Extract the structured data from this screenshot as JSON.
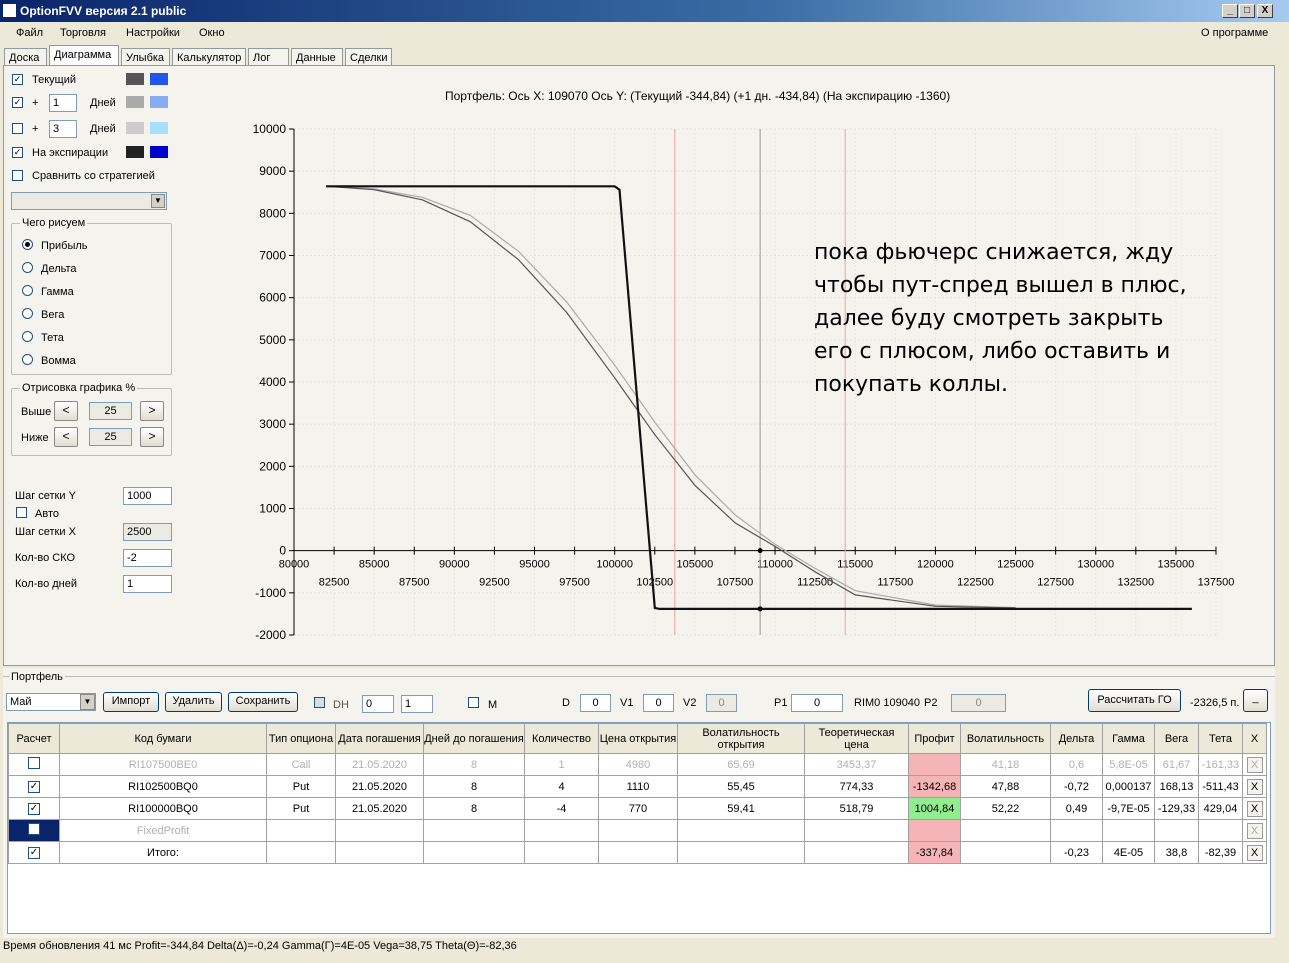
{
  "window": {
    "title": "OptionFVV версия 2.1 public",
    "min": "_",
    "max": "□",
    "close": "X"
  },
  "menu": {
    "file": "Файл",
    "trade": "Торговля",
    "settings": "Настройки",
    "window": "Окно",
    "about": "О программе"
  },
  "tabs": [
    "Доска",
    "Диаграмма",
    "Улыбка",
    "Калькулятор",
    "Лог",
    "Данные",
    "Сделки"
  ],
  "left": {
    "current": "Текущий",
    "plus": "+",
    "days": "Дней",
    "plus1_value": "1",
    "plus3_value": "3",
    "expiry": "На экспирации",
    "compare": "Сравнить со стратегией",
    "draw_group": "Чего рисуем",
    "draw_opts": [
      "Прибыль",
      "Дельта",
      "Гамма",
      "Вега",
      "Тета",
      "Вомма"
    ],
    "render_group": "Отрисовка графика %",
    "above": "Выше",
    "below": "Ниже",
    "above_val": "25",
    "below_val": "25",
    "prev": "<",
    "next": ">",
    "stepy_label": "Шаг сетки Y",
    "stepy": "1000",
    "auto": "Авто",
    "stepx_label": "Шаг сетки X",
    "stepx": "2500",
    "sko_label": "Кол-во СКО",
    "sko": "-2",
    "days_label": "Кол-во дней",
    "days_val": "1",
    "colors": {
      "current_dark": "#555555",
      "current_light": "#2255ee",
      "p1_dark": "#aaaaaa",
      "p1_light": "#88aaee",
      "p3_dark": "#cccccc",
      "p3_light": "#aaddff",
      "exp_dark": "#222222",
      "exp_light": "#0000cc"
    }
  },
  "chart_header": "Портфель: Ось X:  109070 Ось Y:  (Текущий -344,84)  (+1 дн. -434,84)  (На экспирацию -1360)",
  "annotation": [
    "пока фьючерс снижается, жду",
    "чтобы пут-спред вышел в плюс,",
    "далее буду смотреть закрыть",
    "его с плюсом, либо оставить и",
    "покупать коллы."
  ],
  "chart_data": {
    "type": "line",
    "xlim": [
      80000,
      137500
    ],
    "ylim": [
      -2000,
      10000
    ],
    "y_ticks": [
      "10000",
      "9000",
      "8000",
      "7000",
      "6000",
      "5000",
      "4000",
      "3000",
      "2000",
      "1000",
      "0",
      "-1000",
      "-2000"
    ],
    "x_ticks_top": [
      "80000",
      "85000",
      "90000",
      "95000",
      "100000",
      "105000",
      "110000",
      "115000",
      "120000",
      "125000",
      "130000",
      "135000"
    ],
    "x_ticks_bottom": [
      "82500",
      "87500",
      "92500",
      "97500",
      "102500",
      "107500",
      "112500",
      "117500",
      "122500",
      "127500",
      "132500",
      "137500"
    ],
    "cursor_x": 109070,
    "red_lines": [
      103750,
      114375
    ],
    "series": [
      {
        "x": [
          82000,
          100000,
          100300,
          102500,
          102800,
          136000
        ],
        "y": [
          8640,
          8640,
          8560,
          -1360,
          -1380,
          -1380
        ]
      },
      {
        "x": [
          82000,
          85000,
          88000,
          91000,
          94000,
          97000,
          100000,
          102500,
          105000,
          107500,
          110000,
          112500,
          115000,
          120000,
          125000
        ],
        "y": [
          8640,
          8560,
          8320,
          7800,
          6900,
          5650,
          4100,
          2750,
          1550,
          660,
          100,
          -500,
          -1050,
          -1320,
          -1360
        ]
      },
      {
        "x": [
          82000,
          85000,
          88000,
          91000,
          94000,
          97000,
          100000,
          102500,
          105000,
          107500,
          110000,
          112500,
          115000,
          120000,
          125000
        ],
        "y": [
          8640,
          8580,
          8380,
          7950,
          7100,
          5900,
          4400,
          3050,
          1800,
          850,
          150,
          -420,
          -950,
          -1290,
          -1350
        ]
      }
    ]
  },
  "portfolio": {
    "group": "Портфель",
    "month": "Май",
    "import": "Импорт",
    "delete": "Удалить",
    "save": "Сохранить",
    "dh": "DH",
    "dh_val1": "0",
    "dh_val2": "1",
    "m": "M",
    "d_label": "D",
    "d": "0",
    "v1_label": "V1",
    "v1": "0",
    "v2_label": "V2",
    "v2": "0",
    "p1_label": "P1",
    "p1": "0",
    "rim": "RIM0 109040",
    "p2_label": "P2",
    "p2": "0",
    "calc_go": "Рассчитать ГО",
    "go_value": "-2326,5 п.",
    "go_btn": "_",
    "headers": [
      "Расчет",
      "Код бумаги",
      "Тип опциона",
      "Дата погашения",
      "Дней до погашения",
      "Количество",
      "Цена открытия",
      "Волатильность открытия",
      "Теоретическая цена",
      "Профит",
      "Волатильность",
      "Дельта",
      "Гамма",
      "Вега",
      "Тета",
      "X"
    ],
    "rows": [
      {
        "check": "",
        "code": "RI107500BE0",
        "type": "Call",
        "date": "21.05.2020",
        "days": "8",
        "qty": "1",
        "price": "4980",
        "vol": "65,69",
        "theo": "3453,37",
        "profit": "",
        "vol2": "41,18",
        "delta": "0,6",
        "gamma": "5,8E-05",
        "vega": "61,67",
        "theta": "-161,33",
        "x": "X"
      },
      {
        "check": "✓",
        "code": "RI102500BQ0",
        "type": "Put",
        "date": "21.05.2020",
        "days": "8",
        "qty": "4",
        "price": "1110",
        "vol": "55,45",
        "theo": "774,33",
        "profit": "-1342,68",
        "vol2": "47,88",
        "delta": "-0,72",
        "gamma": "0,000137",
        "vega": "168,13",
        "theta": "-511,43",
        "x": "X"
      },
      {
        "check": "✓",
        "code": "RI100000BQ0",
        "type": "Put",
        "date": "21.05.2020",
        "days": "8",
        "qty": "-4",
        "price": "770",
        "vol": "59,41",
        "theo": "518,79",
        "profit": "1004,84",
        "vol2": "52,22",
        "delta": "0,49",
        "gamma": "-9,7E-05",
        "vega": "-129,33",
        "theta": "429,04",
        "x": "X"
      },
      {
        "check": "",
        "code": "FixedProfit",
        "type": "",
        "date": "",
        "days": "",
        "qty": "",
        "price": "",
        "vol": "",
        "theo": "",
        "profit": "",
        "vol2": "",
        "delta": "",
        "gamma": "",
        "vega": "",
        "theta": "",
        "x": "X"
      },
      {
        "check": "✓",
        "code": "Итого:",
        "type": "",
        "date": "",
        "days": "",
        "qty": "",
        "price": "",
        "vol": "",
        "theo": "",
        "profit": "-337,84",
        "vol2": "",
        "delta": "-0,23",
        "gamma": "4E-05",
        "vega": "38,8",
        "theta": "-82,39",
        "x": "X"
      }
    ]
  },
  "status": "Время обновления 41 мс  Profit=-344,84 Delta(Δ)=-0,24 Gamma(Γ)=4E-05 Vega=38,75 Theta(Θ)=-82,36"
}
